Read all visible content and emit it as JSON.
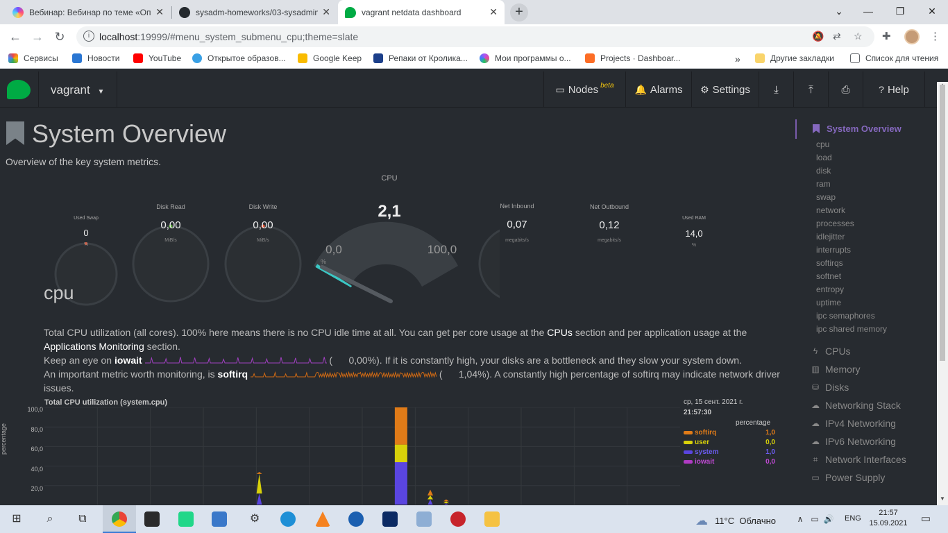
{
  "browser": {
    "tabs": [
      {
        "title": "Вебинар: Вебинар по теме «Опе",
        "favicon_color": "#7b4dff"
      },
      {
        "title": "sysadm-homeworks/03-sysadmin",
        "favicon_color": "#24292e"
      },
      {
        "title": "vagrant netdata dashboard",
        "favicon_color": "#00ab44"
      }
    ],
    "url_host": "localhost",
    "url_rest": ":19999/#menu_system_submenu_cpu;theme=slate",
    "bookmarks": [
      {
        "label": "Сервисы",
        "color": "#e44"
      },
      {
        "label": "Новости",
        "color": "#2a76d2"
      },
      {
        "label": "YouTube",
        "color": "#f00"
      },
      {
        "label": "Открытое образов...",
        "color": "#39a0e5"
      },
      {
        "label": "Google Keep",
        "color": "#f9bb00"
      },
      {
        "label": "Репаки от Кролика...",
        "color": "#1c3f8a"
      },
      {
        "label": "Мои программы о...",
        "color": "#a855f7"
      },
      {
        "label": "Projects · Dashboar...",
        "color": "#fc6d26"
      }
    ],
    "other_bookmarks": "Другие закладки",
    "reading_list": "Список для чтения"
  },
  "netdata": {
    "hostname": "vagrant",
    "nav": {
      "nodes": "Nodes",
      "beta": "beta",
      "alarms": "Alarms",
      "settings": "Settings",
      "help": "Help"
    },
    "page_title": "System Overview",
    "page_subtitle": "Overview of the key system metrics.",
    "gauges": {
      "used_swap": {
        "label": "Used Swap",
        "value": "0",
        "unit": "%"
      },
      "disk_read": {
        "label": "Disk Read",
        "value": "0,00",
        "unit": "MiB/s"
      },
      "disk_write": {
        "label": "Disk Write",
        "value": "0,00",
        "unit": "MiB/s"
      },
      "cpu": {
        "label": "CPU",
        "value": "2,1",
        "min": "0,0",
        "max": "100,0",
        "unit": "%",
        "level": 0.021
      },
      "net_inbound": {
        "label": "Net Inbound",
        "value": "0,07",
        "unit": "megabits/s",
        "level": 0.45
      },
      "net_outbound": {
        "label": "Net Outbound",
        "value": "0,12",
        "unit": "megabits/s",
        "level": 0.08
      },
      "used_ram": {
        "label": "Used RAM",
        "value": "14,0",
        "unit": "%",
        "level": 0.14
      }
    },
    "section_heading": "cpu",
    "para1_a": "Total CPU utilization (all cores). 100% here means there is no CPU idle time at all. You can get per core usage at the",
    "para1_cpus": "CPUs",
    "para1_b": "section and per application usage at the",
    "para1_apps": "Applications Monitoring",
    "para1_c": "section.",
    "para2_a": "Keep an eye on",
    "para2_iowait": "iowait",
    "para2_val": "0,00%",
    "para2_b": "). If it is constantly high, your disks are a bottleneck and they slow your system down.",
    "para3_a": "An important metric worth monitoring, is",
    "para3_softirq": "softirq",
    "para3_val": "1,04%",
    "para3_b": "). A constantly high percentage of softirq may indicate network driver",
    "para3_c": "issues.",
    "chart_title": "Total CPU utilization (system.cpu)",
    "chart_ylabel": "percentage",
    "legend_date": "ср, 15 сент. 2021 г.",
    "legend_time": "21:57:30",
    "legend_unit": "percentage",
    "sidebar": {
      "active": "System Overview",
      "subitems": [
        "cpu",
        "load",
        "disk",
        "ram",
        "swap",
        "network",
        "processes",
        "idlejitter",
        "interrupts",
        "softirqs",
        "softnet",
        "entropy",
        "uptime",
        "ipc semaphores",
        "ipc shared memory"
      ],
      "sections": [
        {
          "label": "CPUs",
          "icon": "bolt-icon"
        },
        {
          "label": "Memory",
          "icon": "memory-icon"
        },
        {
          "label": "Disks",
          "icon": "disk-icon"
        },
        {
          "label": "Networking Stack",
          "icon": "cloud-icon"
        },
        {
          "label": "IPv4 Networking",
          "icon": "cloud-icon"
        },
        {
          "label": "IPv6 Networking",
          "icon": "cloud-icon"
        },
        {
          "label": "Network Interfaces",
          "icon": "sitemap-icon"
        },
        {
          "label": "Power Supply",
          "icon": "battery-icon"
        }
      ]
    }
  },
  "chart_data": {
    "type": "area",
    "title": "Total CPU utilization (system.cpu)",
    "ylabel": "percentage",
    "yticks": [
      "100,0",
      "80,0",
      "60,0",
      "40,0",
      "20,0"
    ],
    "ylim": [
      0,
      100
    ],
    "series": [
      {
        "name": "softirq",
        "color": "#e07b18",
        "value": "1,0"
      },
      {
        "name": "user",
        "color": "#d8d10a",
        "value": "0,0"
      },
      {
        "name": "system",
        "color": "#5a45e0",
        "value": "1,0"
      },
      {
        "name": "iowait",
        "color": "#b03bc4",
        "value": "0,0"
      }
    ],
    "spikes": [
      {
        "x": 0.338,
        "softirq": 2,
        "user": 20,
        "system": 12,
        "iowait": 0
      },
      {
        "x": 0.561,
        "softirq": 38,
        "user": 18,
        "system": 44,
        "iowait": 0
      },
      {
        "x": 0.607,
        "softirq": 6,
        "user": 4,
        "system": 6,
        "iowait": 0
      },
      {
        "x": 0.632,
        "softirq": 2,
        "user": 2,
        "system": 2,
        "iowait": 0
      }
    ]
  },
  "taskbar": {
    "weather": "11°C",
    "weather_text": "Облачно",
    "lang": "ENG",
    "time": "21:57",
    "date": "15.09.2021"
  }
}
